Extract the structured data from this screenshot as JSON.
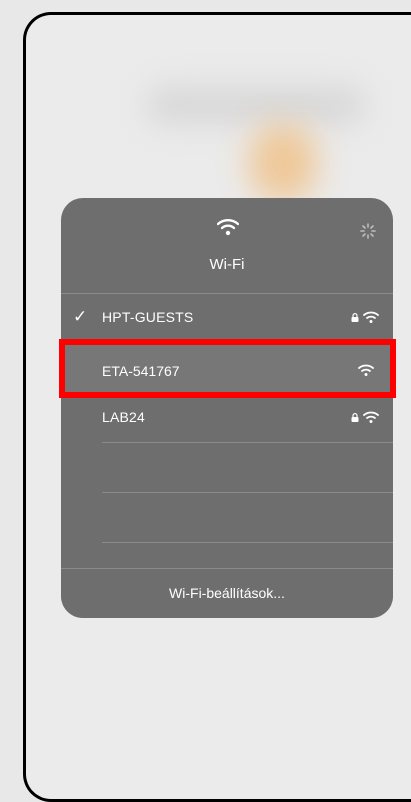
{
  "panel": {
    "title": "Wi-Fi",
    "header_icon": "wifi-icon",
    "activity_icon": "spinner-icon"
  },
  "networks": [
    {
      "name": "HPT-GUESTS",
      "connected": true,
      "check": "✓",
      "locked": true
    },
    {
      "name": "ETA-541767",
      "connected": false,
      "locked": false,
      "highlighted": true
    },
    {
      "name": "LAB24",
      "connected": false,
      "locked": true
    }
  ],
  "footer": {
    "label": "Wi-Fi-beállítások..."
  },
  "colors": {
    "highlight": "#ff0000",
    "panel": "#6e6e6e"
  }
}
